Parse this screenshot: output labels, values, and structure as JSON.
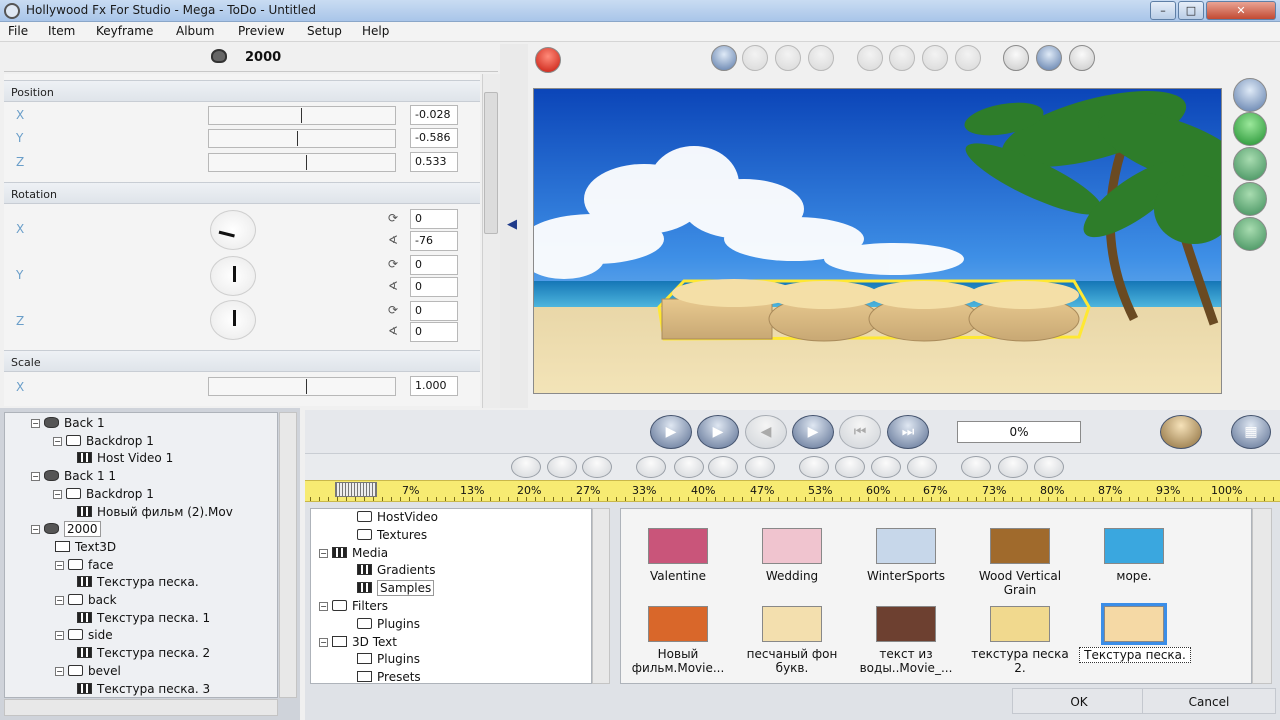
{
  "window": {
    "title": "Hollywood Fx For Studio - Mega - ToDo - Untitled",
    "min": "–",
    "max": "□",
    "close": "✕"
  },
  "menu": [
    "File",
    "Item",
    "Keyframe",
    "Album",
    "Preview",
    "Setup",
    "Help"
  ],
  "properties": {
    "object_name": "2000",
    "position": {
      "label": "Position",
      "x_label": "X",
      "y_label": "Y",
      "z_label": "Z",
      "x": "-0.028",
      "y": "-0.586",
      "z": "0.533"
    },
    "rotation": {
      "label": "Rotation",
      "x_label": "X",
      "y_label": "Y",
      "z_label": "Z",
      "x_turns": "0",
      "x_angle": "-76",
      "y_turns": "0",
      "y_angle": "0",
      "z_turns": "0",
      "z_angle": "0"
    },
    "scale": {
      "label": "Scale",
      "x_label": "X",
      "x": "1.000"
    }
  },
  "tree": [
    {
      "label": "Back 1",
      "icon": "object-icon",
      "expanded": true
    },
    {
      "label": "Backdrop 1",
      "icon": "backdrop-icon",
      "expanded": true
    },
    {
      "label": "Host Video 1",
      "icon": "film-icon"
    },
    {
      "label": "Back 1 1",
      "icon": "object-icon",
      "expanded": true
    },
    {
      "label": "Backdrop 1",
      "icon": "backdrop-icon",
      "expanded": true
    },
    {
      "label": "Новый фильм (2).Mov",
      "icon": "film-icon"
    },
    {
      "label": "2000",
      "icon": "object-icon",
      "expanded": true,
      "selected": true
    },
    {
      "label": "Text3D",
      "icon": "text3d-icon"
    },
    {
      "label": "face",
      "icon": "backdrop-icon",
      "expanded": true
    },
    {
      "label": "Текстура песка.",
      "icon": "film-icon"
    },
    {
      "label": "back",
      "icon": "backdrop-icon",
      "expanded": true
    },
    {
      "label": "Текстура песка. 1",
      "icon": "film-icon"
    },
    {
      "label": "side",
      "icon": "backdrop-icon",
      "expanded": true
    },
    {
      "label": "Текстура песка. 2",
      "icon": "film-icon"
    },
    {
      "label": "bevel",
      "icon": "backdrop-icon",
      "expanded": true
    },
    {
      "label": "Текстура песка. 3",
      "icon": "film-icon"
    }
  ],
  "transport": {
    "progress": "0%"
  },
  "ruler": [
    "7%",
    "13%",
    "20%",
    "27%",
    "33%",
    "40%",
    "47%",
    "53%",
    "60%",
    "67%",
    "73%",
    "80%",
    "87%",
    "93%",
    "100%"
  ],
  "album_tree": [
    {
      "label": "HostVideo",
      "icon": "backdrop-icon"
    },
    {
      "label": "Textures",
      "icon": "backdrop-icon"
    },
    {
      "label": "Media",
      "icon": "film-icon",
      "expanded": true
    },
    {
      "label": "Gradients",
      "icon": "film-icon"
    },
    {
      "label": "Samples",
      "icon": "film-icon",
      "selected": true
    },
    {
      "label": "Filters",
      "icon": "filter-icon",
      "expanded": true
    },
    {
      "label": "Plugins",
      "icon": "filter-icon"
    },
    {
      "label": "3D Text",
      "icon": "text-icon",
      "expanded": true
    },
    {
      "label": "Plugins",
      "icon": "text-icon"
    },
    {
      "label": "Presets",
      "icon": "text-icon"
    }
  ],
  "album_items": [
    {
      "label": "Valentine",
      "color": "#c9557a"
    },
    {
      "label": "Wedding",
      "color": "#f0c4cf"
    },
    {
      "label": "WinterSports",
      "color": "#c7d7ea"
    },
    {
      "label": "Wood Vertical Grain",
      "color": "#a06a2c"
    },
    {
      "label": "море.",
      "color": "#3aa7df"
    },
    {
      "label": "Новый фильм.Movie...",
      "color": "#d9672a"
    },
    {
      "label": "песчаный фон букв.",
      "color": "#f3dfae"
    },
    {
      "label": "текст из воды..Movie_...",
      "color": "#6d4030"
    },
    {
      "label": "текстура песка 2.",
      "color": "#f1d98e"
    },
    {
      "label": "Текстура песка.",
      "color": "#f5d9a5",
      "selected": true
    }
  ],
  "buttons": {
    "ok": "OK",
    "cancel": "Cancel"
  }
}
